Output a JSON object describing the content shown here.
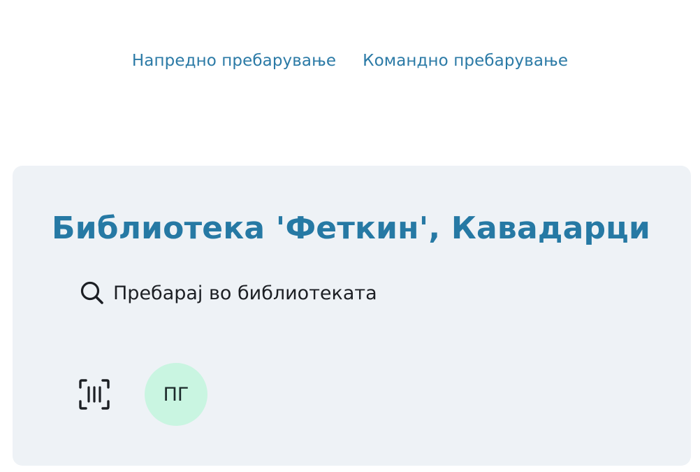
{
  "header": {
    "links": [
      {
        "label": "Напредно пребарување"
      },
      {
        "label": "Командно пребарување"
      }
    ]
  },
  "library": {
    "title": "Библиотека 'Феткин', Кавадарци",
    "search_label": "Пребарај во библиотеката"
  },
  "actions": {
    "scanner_icon": "barcode-scan-icon",
    "avatar_initials": "ПГ"
  },
  "colors": {
    "accent": "#2679a4",
    "link": "#2b7aa6",
    "card_background": "#eef2f6",
    "avatar_background": "#c9f5e1"
  }
}
